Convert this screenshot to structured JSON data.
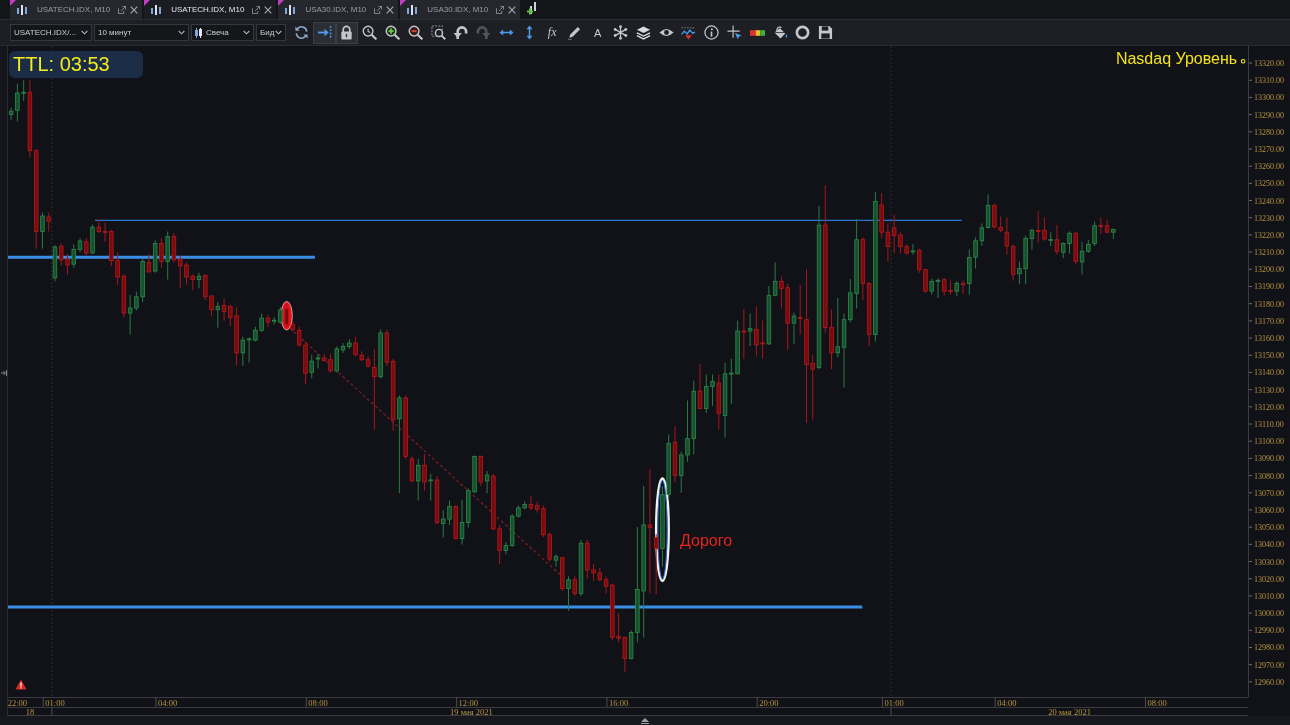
{
  "tabs": [
    {
      "label": "USATECH.IDX, M10",
      "selected": false
    },
    {
      "label": "USATECH.IDX, M10",
      "selected": true
    },
    {
      "label": "USA30.IDX, M10",
      "selected": false
    },
    {
      "label": "USA30.IDX, M10",
      "selected": false
    }
  ],
  "toolbar": {
    "selectors": [
      {
        "kind": "text",
        "value": "USATECH.IDX/..."
      },
      {
        "kind": "text",
        "value": "10 минут"
      },
      {
        "kind": "candle",
        "value": "Свеча"
      },
      {
        "kind": "text",
        "value": "Бид"
      }
    ],
    "tools": [
      {
        "kind": "refresh",
        "on": false,
        "disabled": false
      },
      {
        "kind": "scroll-end",
        "on": true,
        "disabled": false
      },
      {
        "kind": "lock",
        "on": true,
        "disabled": false
      },
      {
        "kind": "zoom-reset",
        "on": false,
        "disabled": false
      },
      {
        "kind": "zoom-in",
        "on": false,
        "disabled": false
      },
      {
        "kind": "zoom-out",
        "on": false,
        "disabled": false
      },
      {
        "kind": "zoom-fit",
        "on": false,
        "disabled": false
      },
      {
        "kind": "undo",
        "on": false,
        "disabled": false
      },
      {
        "kind": "redo",
        "on": false,
        "disabled": true
      },
      {
        "kind": "pan-horizontal",
        "on": false,
        "disabled": false
      },
      {
        "kind": "pan-vertical",
        "on": false,
        "disabled": false
      },
      {
        "kind": "formula",
        "label": "fx",
        "on": false,
        "disabled": false
      },
      {
        "kind": "pencil",
        "on": false,
        "disabled": false
      },
      {
        "kind": "text",
        "label": "A",
        "on": false,
        "disabled": false
      },
      {
        "kind": "objects",
        "on": false,
        "disabled": false
      },
      {
        "kind": "layers",
        "on": false,
        "disabled": false
      },
      {
        "kind": "eye",
        "on": false,
        "disabled": false
      },
      {
        "kind": "indicator",
        "on": false,
        "disabled": false
      },
      {
        "kind": "info",
        "on": false,
        "disabled": false
      },
      {
        "kind": "crosshair",
        "on": false,
        "disabled": false
      },
      {
        "kind": "colors",
        "on": false,
        "disabled": false
      },
      {
        "kind": "fill",
        "on": false,
        "disabled": false
      },
      {
        "kind": "circle",
        "on": false,
        "disabled": false
      },
      {
        "kind": "save",
        "on": false,
        "disabled": false
      }
    ]
  },
  "chart": {
    "ttl": "TTL: 03:53",
    "date_labels": [
      "18",
      "19 мая 2021",
      "20 мая 2021"
    ],
    "chart_data": [
      {
        "type": "candlestick",
        "ylim": [
          12951.2,
          13329.9
        ],
        "annotations": [
          "Дорого",
          "Nasdaq Уровень"
        ],
        "ref_lines": [
          {
            "axis": "y",
            "value": 13228.5,
            "color": "#2f74cc",
            "line_style": "solid"
          },
          {
            "axis": "y",
            "value": 13207,
            "color": "#3a8ee6",
            "line_style": "solid"
          },
          {
            "axis": "y",
            "value": 13003.5,
            "color": "#3a8ee6",
            "line_style": "solid"
          }
        ],
        "yticks": [
          {
            "value": 13320,
            "label": "13320.00"
          },
          {
            "value": 13310,
            "label": "13310.00"
          },
          {
            "value": 13300,
            "label": "13300.00"
          },
          {
            "value": 13290,
            "label": "13290.00"
          },
          {
            "value": 13280,
            "label": "13280.00"
          },
          {
            "value": 13270,
            "label": "13270.00"
          },
          {
            "value": 13260,
            "label": "13260.00"
          },
          {
            "value": 13250,
            "label": "13250.00"
          },
          {
            "value": 13240,
            "label": "13240.00"
          },
          {
            "value": 13230,
            "label": "13230.00"
          },
          {
            "value": 13220,
            "label": "13220.00"
          },
          {
            "value": 13210,
            "label": "13210.00"
          },
          {
            "value": 13200,
            "label": "13200.00"
          },
          {
            "value": 13190,
            "label": "13190.00"
          },
          {
            "value": 13180,
            "label": "13180.00"
          },
          {
            "value": 13170,
            "label": "13170.00"
          },
          {
            "value": 13160,
            "label": "13160.00"
          },
          {
            "value": 13150,
            "label": "13150.00"
          },
          {
            "value": 13140,
            "label": "13140.00"
          },
          {
            "value": 13130,
            "label": "13130.00"
          },
          {
            "value": 13120,
            "label": "13120.00"
          },
          {
            "value": 13110,
            "label": "13110.00"
          },
          {
            "value": 13100,
            "label": "13100.00"
          },
          {
            "value": 13090,
            "label": "13090.00"
          },
          {
            "value": 13080,
            "label": "13080.00"
          },
          {
            "value": 13070,
            "label": "13070.00"
          },
          {
            "value": 13060,
            "label": "13060.00"
          },
          {
            "value": 13050,
            "label": "13050.00"
          },
          {
            "value": 13040,
            "label": "13040.00"
          },
          {
            "value": 13030,
            "label": "13030.00"
          },
          {
            "value": 13020,
            "label": "13020.00"
          },
          {
            "value": 13010,
            "label": "13010.00"
          },
          {
            "value": 13000,
            "label": "13000.00"
          },
          {
            "value": 12990,
            "label": "12990.00"
          },
          {
            "value": 12980,
            "label": "12980.00"
          },
          {
            "value": 12970,
            "label": "12970.00"
          },
          {
            "value": 12960,
            "label": "12960.00"
          }
        ],
        "categories": [
          null,
          "22:00",
          null,
          null,
          null,
          null,
          null,
          "01:00",
          null,
          null,
          null,
          null,
          null,
          null,
          null,
          null,
          null,
          null,
          null,
          null,
          null,
          null,
          null,
          null,
          null,
          "04:00",
          null,
          null,
          null,
          null,
          null,
          null,
          null,
          null,
          null,
          null,
          null,
          null,
          null,
          null,
          null,
          null,
          null,
          null,
          null,
          null,
          null,
          null,
          null,
          "08:00",
          null,
          null,
          null,
          null,
          null,
          null,
          null,
          null,
          null,
          null,
          null,
          null,
          null,
          null,
          null,
          null,
          null,
          null,
          null,
          null,
          null,
          null,
          null,
          "12:00",
          null,
          null,
          null,
          null,
          null,
          null,
          null,
          null,
          null,
          null,
          null,
          null,
          null,
          null,
          null,
          null,
          null,
          null,
          null,
          null,
          null,
          null,
          null,
          "16:00",
          null,
          null,
          null,
          null,
          null,
          null,
          null,
          null,
          null,
          null,
          null,
          null,
          null,
          null,
          null,
          null,
          null,
          null,
          null,
          null,
          null,
          null,
          null,
          "20:00",
          null,
          null,
          null,
          null,
          null,
          null,
          null,
          null,
          null,
          null,
          null,
          null,
          null,
          null,
          null,
          null,
          null,
          null,
          null,
          "01:00",
          null,
          null,
          null,
          null,
          null,
          null,
          null,
          null,
          null,
          null,
          null,
          null,
          null,
          null,
          null,
          null,
          null,
          "04:00",
          null,
          null,
          null,
          null,
          null,
          null,
          null,
          null,
          null,
          null,
          null,
          null,
          null,
          null,
          null,
          null,
          null,
          null,
          null,
          null,
          null,
          null,
          null,
          "08:00",
          null,
          null,
          null,
          null,
          null,
          null,
          null,
          null,
          null,
          null,
          null,
          null,
          null,
          null
        ],
        "ohlc": [
          [
            13290,
            13294,
            13287,
            13292
          ],
          [
            13292.5,
            13308,
            13286,
            13302.5
          ],
          [
            13302.5,
            13310,
            13298,
            13303
          ],
          [
            13303,
            13310,
            13265,
            13269
          ],
          [
            13269,
            13270,
            13212,
            13222
          ],
          [
            13222,
            13233,
            13212,
            13231
          ],
          [
            13230.5,
            13233,
            13222,
            13228
          ],
          [
            13195,
            13214,
            13193,
            13213
          ],
          [
            13213.5,
            13215,
            13202.5,
            13205.5
          ],
          [
            13206,
            13209,
            13197,
            13202.5
          ],
          [
            13203,
            13214.5,
            13201,
            13211.5
          ],
          [
            13211.5,
            13218,
            13210,
            13216.5
          ],
          [
            13216,
            13218,
            13208,
            13209.5
          ],
          [
            13209.5,
            13226,
            13209,
            13224.5
          ],
          [
            13224.5,
            13229,
            13221,
            13222
          ],
          [
            13222,
            13227,
            13216,
            13221.5
          ],
          [
            13222,
            13223,
            13202,
            13205
          ],
          [
            13205,
            13210,
            13191,
            13195.5
          ],
          [
            13196,
            13197,
            13172,
            13174.5
          ],
          [
            13174.5,
            13185,
            13162,
            13177.5
          ],
          [
            13177.5,
            13187,
            13176,
            13184
          ],
          [
            13184,
            13206,
            13181,
            13204.5
          ],
          [
            13204,
            13209,
            13198,
            13198.5
          ],
          [
            13199,
            13217,
            13198,
            13215
          ],
          [
            13215,
            13218,
            13201,
            13204.5
          ],
          [
            13204.5,
            13222,
            13194,
            13219
          ],
          [
            13219,
            13221,
            13204,
            13205.5
          ],
          [
            13206,
            13208,
            13189,
            13202
          ],
          [
            13202.5,
            13204,
            13191,
            13195.5
          ],
          [
            13196,
            13197,
            13188,
            13194
          ],
          [
            13194,
            13198,
            13189,
            13196
          ],
          [
            13196.5,
            13197,
            13182,
            13184
          ],
          [
            13184.5,
            13185,
            13173,
            13176.5
          ],
          [
            13176.5,
            13181,
            13166,
            13178.5
          ],
          [
            13179,
            13183,
            13170,
            13175.5
          ],
          [
            13178.5,
            13179,
            13167,
            13172
          ],
          [
            13173,
            13178,
            13143.7,
            13151.4
          ],
          [
            13151.4,
            13160.8,
            13143.7,
            13158.8
          ],
          [
            13159,
            13160.5,
            13145.7,
            13159.5
          ],
          [
            13158.8,
            13166.5,
            13158,
            13164.5
          ],
          [
            13164.5,
            13174.2,
            13163.6,
            13171.6
          ],
          [
            13171.6,
            13173.6,
            13166.5,
            13169.3
          ],
          [
            13170,
            13172.2,
            13167.9,
            13170.4
          ],
          [
            13169.3,
            13177.9,
            13168.5,
            13176.4
          ],
          [
            13177,
            13179.9,
            13166.5,
            13167.9
          ],
          [
            13167.9,
            13169.3,
            13163.6,
            13165
          ],
          [
            13164.5,
            13166.5,
            13155.1,
            13155.9
          ],
          [
            13155.9,
            13157.9,
            13133.2,
            13139.4
          ],
          [
            13140,
            13150.3,
            13136.6,
            13146.6
          ],
          [
            13147.8,
            13150.8,
            13142.3,
            13148.5
          ],
          [
            13148.5,
            13150.8,
            13146.5,
            13146.8
          ],
          [
            13147.4,
            13150.8,
            13140,
            13140.9
          ],
          [
            13140.9,
            13155.1,
            13140,
            13153.7
          ],
          [
            13153.1,
            13157.1,
            13151.4,
            13155.1
          ],
          [
            13155.1,
            13159.4,
            13153.7,
            13157.1
          ],
          [
            13157.1,
            13160.8,
            13149.4,
            13150.3
          ],
          [
            13150,
            13152.3,
            13146.6,
            13147.4
          ],
          [
            13147.4,
            13149.4,
            13142.9,
            13143.7
          ],
          [
            13142.9,
            13153.7,
            13106.7,
            13137.5
          ],
          [
            13137.5,
            13165,
            13136.6,
            13163
          ],
          [
            13163,
            13165,
            13143.7,
            13146
          ],
          [
            13146.5,
            13148,
            13106,
            13112.4
          ],
          [
            13113,
            13126.6,
            13069.8,
            13125.2
          ],
          [
            13125.2,
            13126.6,
            13089.7,
            13091.1
          ],
          [
            13089.7,
            13091.1,
            13076.3,
            13076.9
          ],
          [
            13076.9,
            13089.7,
            13065.5,
            13086
          ],
          [
            13086,
            13092.5,
            13071.2,
            13076.3
          ],
          [
            13077,
            13081.1,
            13065.5,
            13077.5
          ],
          [
            13077.4,
            13079.7,
            13051.8,
            13052.7
          ],
          [
            13052.1,
            13059.8,
            13044.1,
            13054.7
          ],
          [
            13054.7,
            13065.5,
            13051.3,
            13062.1
          ],
          [
            13062.1,
            13062.7,
            13042.7,
            13043.3
          ],
          [
            13043.3,
            13066,
            13039.9,
            13052.7
          ],
          [
            13052.7,
            13072.6,
            13049.8,
            13071.2
          ],
          [
            13070.6,
            13091.7,
            13069.8,
            13091.1
          ],
          [
            13091.1,
            13091.7,
            13074,
            13076.3
          ],
          [
            13076.9,
            13082.6,
            13069.8,
            13080.3
          ],
          [
            13079.7,
            13081.1,
            13048.4,
            13049
          ],
          [
            13049,
            13051.3,
            13028.5,
            13036.5
          ],
          [
            13036.5,
            13041.3,
            13034.2,
            13039.3
          ],
          [
            13039.3,
            13057.5,
            13038.5,
            13056.4
          ],
          [
            13056.4,
            13062.6,
            13055.5,
            13061.2
          ],
          [
            13061.2,
            13064.9,
            13060.4,
            13063.2
          ],
          [
            13063.2,
            13068.3,
            13059.8,
            13061.2
          ],
          [
            13062.6,
            13064.9,
            13058.4,
            13060.4
          ],
          [
            13060.7,
            13062.6,
            13044.2,
            13045.6
          ],
          [
            13045.6,
            13047,
            13029.9,
            13031.4
          ],
          [
            13030.8,
            13034.2,
            13027.1,
            13032.8
          ],
          [
            13032.2,
            13032.8,
            13012.9,
            13014.3
          ],
          [
            13014.3,
            13021.4,
            13001.5,
            13019.4
          ],
          [
            13019.4,
            13021.4,
            13010,
            13011.4
          ],
          [
            13011.4,
            13042.7,
            13010,
            13040.7
          ],
          [
            13040.7,
            13042.7,
            13020,
            13025.1
          ],
          [
            13025.1,
            13028.5,
            13018.6,
            13023.4
          ],
          [
            13023.4,
            13026.2,
            13018.6,
            13019.4
          ],
          [
            13019.4,
            13021.4,
            13011.4,
            13015.7
          ],
          [
            13016.3,
            13017.1,
            12984.4,
            12985.8
          ],
          [
            12986.4,
            13000,
            12983,
            12985.3
          ],
          [
            12985.8,
            12986.4,
            12965.9,
            12973.6
          ],
          [
            12973.6,
            12990.1,
            12973,
            12988.7
          ],
          [
            12988.7,
            13050,
            12983,
            13013.7
          ],
          [
            13012.9,
            13074,
            12985.8,
            13051.3
          ],
          [
            13051.3,
            13084,
            13011.4,
            13049.8
          ],
          [
            13044,
            13046,
            13011,
            13037.6
          ],
          [
            13037.6,
            13074,
            13027.1,
            13068.9
          ],
          [
            13069,
            13104,
            13066,
            13098.8
          ],
          [
            13099.4,
            13108.5,
            13076,
            13080
          ],
          [
            13080,
            13094,
            13070,
            13092
          ],
          [
            13092,
            13123.7,
            13088,
            13101.5
          ],
          [
            13101.5,
            13135.2,
            13092.4,
            13129.1
          ],
          [
            13129.1,
            13144.9,
            13118.6,
            13119
          ],
          [
            13119,
            13138.8,
            13116.6,
            13131.8
          ],
          [
            13131.8,
            13138.8,
            13120.6,
            13134.8
          ],
          [
            13133.8,
            13138.8,
            13106.9,
            13116.2
          ],
          [
            13115,
            13145.5,
            13102.1,
            13139.2
          ],
          [
            13139.2,
            13147.9,
            13121.6,
            13139.6
          ],
          [
            13139.2,
            13170.1,
            13138.8,
            13164.1
          ],
          [
            13164.1,
            13176.8,
            13147.9,
            13163.5
          ],
          [
            13164.1,
            13174.2,
            13155.4,
            13165.5
          ],
          [
            13165.1,
            13178.2,
            13149.3,
            13156
          ],
          [
            13157.2,
            13170.1,
            13147.9,
            13157
          ],
          [
            13156.6,
            13190.3,
            13156,
            13184.7
          ],
          [
            13184.9,
            13204.1,
            13184.3,
            13193
          ],
          [
            13193,
            13195.8,
            13177.2,
            13188.9
          ],
          [
            13189.3,
            13191.8,
            13153,
            13168.5
          ],
          [
            13168.7,
            13174.8,
            13156.4,
            13172.8
          ],
          [
            13172,
            13190.9,
            13162.1,
            13171.6
          ],
          [
            13170.7,
            13200,
            13110.5,
            13144.5
          ],
          [
            13145.3,
            13150,
            13112.6,
            13141.9
          ],
          [
            13142.9,
            13236.8,
            13141.9,
            13225.7
          ],
          [
            13225.7,
            13248.9,
            13163.1,
            13166.1
          ],
          [
            13166.1,
            13176.8,
            13141.9,
            13151.4
          ],
          [
            13151.4,
            13183.3,
            13148.9,
            13155
          ],
          [
            13154.6,
            13174.2,
            13131.2,
            13170.7
          ],
          [
            13170.7,
            13194.4,
            13169.1,
            13186.3
          ],
          [
            13185.9,
            13229.3,
            13177.2,
            13217.2
          ],
          [
            13217.2,
            13218.6,
            13182.3,
            13191.8
          ],
          [
            13191.8,
            13192.4,
            13155.4,
            13162.1
          ],
          [
            13162.1,
            13244.9,
            13158,
            13239.4
          ],
          [
            13237.4,
            13244.3,
            13218,
            13221.6
          ],
          [
            13221.6,
            13226.7,
            13204.5,
            13213.2
          ],
          [
            13224.1,
            13231.7,
            13209.5,
            13219.6
          ],
          [
            13220,
            13221.6,
            13209.5,
            13213.2
          ],
          [
            13213.2,
            13214.6,
            13208.5,
            13209.5
          ],
          [
            13210.3,
            13214.6,
            13208.5,
            13210.7
          ],
          [
            13211.1,
            13212,
            13197.8,
            13199.8
          ],
          [
            13199.8,
            13200.4,
            13186.3,
            13187.3
          ],
          [
            13187.3,
            13194.4,
            13185.3,
            13193
          ],
          [
            13193.2,
            13194.8,
            13183.3,
            13193.6
          ],
          [
            13194,
            13194.8,
            13184.9,
            13187.3
          ],
          [
            13187.7,
            13193.4,
            13185.3,
            13187.3
          ],
          [
            13187.3,
            13193,
            13184.3,
            13191.8
          ],
          [
            13191.6,
            13193.4,
            13185.7,
            13191.1
          ],
          [
            13191.8,
            13211.5,
            13185.3,
            13206.9
          ],
          [
            13207.1,
            13218.6,
            13200.4,
            13216.6
          ],
          [
            13216.6,
            13226.7,
            13213.6,
            13224.1
          ],
          [
            13224.3,
            13243.5,
            13223.7,
            13237.2
          ],
          [
            13237.2,
            13238.2,
            13223.7,
            13224.7
          ],
          [
            13224.3,
            13230.7,
            13221.6,
            13222.7
          ],
          [
            13221.6,
            13230.1,
            13208.5,
            13213.6
          ],
          [
            13213.2,
            13214.6,
            13193.4,
            13197
          ],
          [
            13197.4,
            13204.5,
            13191.3,
            13200.4
          ],
          [
            13200.4,
            13219.6,
            13191.3,
            13218
          ],
          [
            13218,
            13223.7,
            13211.5,
            13222.7
          ],
          [
            13222.5,
            13233.8,
            13215.6,
            13222.1
          ],
          [
            13222.7,
            13230.1,
            13216.6,
            13217.6
          ],
          [
            13217.2,
            13221.6,
            13213.6,
            13217.4
          ],
          [
            13217.2,
            13225.7,
            13208.5,
            13210.5
          ],
          [
            13209.9,
            13215.6,
            13206.5,
            13215
          ],
          [
            13215,
            13222,
            13209.1,
            13221
          ],
          [
            13221,
            13221.6,
            13203.1,
            13204.5
          ],
          [
            13204.3,
            13216,
            13197,
            13210.5
          ],
          [
            13210.5,
            13217.2,
            13209.5,
            13214.6
          ],
          [
            13215,
            13227.7,
            13213.6,
            13225.3
          ],
          [
            13225.5,
            13230.1,
            13220.6,
            13225.1
          ],
          [
            13225.3,
            13228.7,
            13221,
            13221.6
          ],
          [
            13221.6,
            13223.7,
            13217.6,
            13223.1
          ],
          null,
          null,
          null,
          null,
          null,
          null,
          null,
          null,
          null,
          null,
          null,
          null,
          null,
          null,
          null,
          null,
          null,
          null,
          null,
          null,
          null
        ]
      }
    ]
  }
}
